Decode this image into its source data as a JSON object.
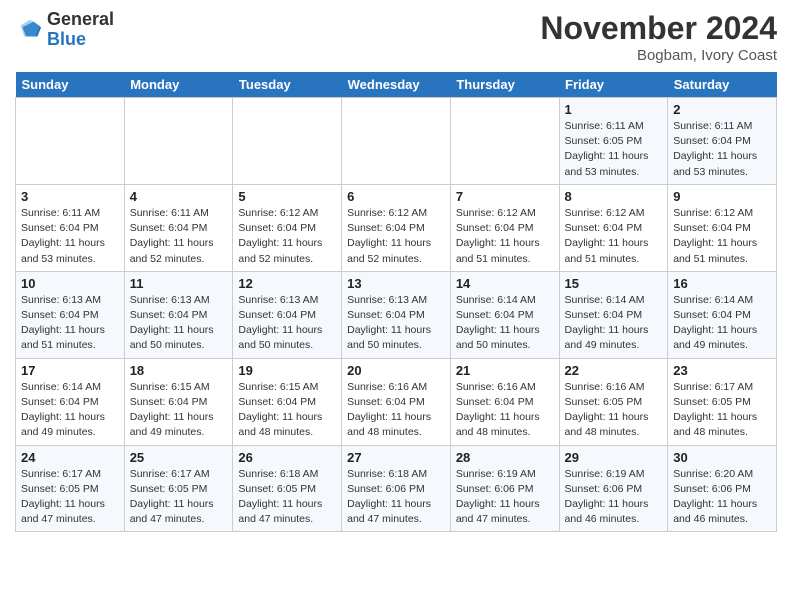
{
  "header": {
    "logo_line1": "General",
    "logo_line2": "Blue",
    "month": "November 2024",
    "location": "Bogbam, Ivory Coast"
  },
  "weekdays": [
    "Sunday",
    "Monday",
    "Tuesday",
    "Wednesday",
    "Thursday",
    "Friday",
    "Saturday"
  ],
  "weeks": [
    [
      {
        "day": "",
        "info": ""
      },
      {
        "day": "",
        "info": ""
      },
      {
        "day": "",
        "info": ""
      },
      {
        "day": "",
        "info": ""
      },
      {
        "day": "",
        "info": ""
      },
      {
        "day": "1",
        "info": "Sunrise: 6:11 AM\nSunset: 6:05 PM\nDaylight: 11 hours and 53 minutes."
      },
      {
        "day": "2",
        "info": "Sunrise: 6:11 AM\nSunset: 6:04 PM\nDaylight: 11 hours and 53 minutes."
      }
    ],
    [
      {
        "day": "3",
        "info": "Sunrise: 6:11 AM\nSunset: 6:04 PM\nDaylight: 11 hours and 53 minutes."
      },
      {
        "day": "4",
        "info": "Sunrise: 6:11 AM\nSunset: 6:04 PM\nDaylight: 11 hours and 52 minutes."
      },
      {
        "day": "5",
        "info": "Sunrise: 6:12 AM\nSunset: 6:04 PM\nDaylight: 11 hours and 52 minutes."
      },
      {
        "day": "6",
        "info": "Sunrise: 6:12 AM\nSunset: 6:04 PM\nDaylight: 11 hours and 52 minutes."
      },
      {
        "day": "7",
        "info": "Sunrise: 6:12 AM\nSunset: 6:04 PM\nDaylight: 11 hours and 51 minutes."
      },
      {
        "day": "8",
        "info": "Sunrise: 6:12 AM\nSunset: 6:04 PM\nDaylight: 11 hours and 51 minutes."
      },
      {
        "day": "9",
        "info": "Sunrise: 6:12 AM\nSunset: 6:04 PM\nDaylight: 11 hours and 51 minutes."
      }
    ],
    [
      {
        "day": "10",
        "info": "Sunrise: 6:13 AM\nSunset: 6:04 PM\nDaylight: 11 hours and 51 minutes."
      },
      {
        "day": "11",
        "info": "Sunrise: 6:13 AM\nSunset: 6:04 PM\nDaylight: 11 hours and 50 minutes."
      },
      {
        "day": "12",
        "info": "Sunrise: 6:13 AM\nSunset: 6:04 PM\nDaylight: 11 hours and 50 minutes."
      },
      {
        "day": "13",
        "info": "Sunrise: 6:13 AM\nSunset: 6:04 PM\nDaylight: 11 hours and 50 minutes."
      },
      {
        "day": "14",
        "info": "Sunrise: 6:14 AM\nSunset: 6:04 PM\nDaylight: 11 hours and 50 minutes."
      },
      {
        "day": "15",
        "info": "Sunrise: 6:14 AM\nSunset: 6:04 PM\nDaylight: 11 hours and 49 minutes."
      },
      {
        "day": "16",
        "info": "Sunrise: 6:14 AM\nSunset: 6:04 PM\nDaylight: 11 hours and 49 minutes."
      }
    ],
    [
      {
        "day": "17",
        "info": "Sunrise: 6:14 AM\nSunset: 6:04 PM\nDaylight: 11 hours and 49 minutes."
      },
      {
        "day": "18",
        "info": "Sunrise: 6:15 AM\nSunset: 6:04 PM\nDaylight: 11 hours and 49 minutes."
      },
      {
        "day": "19",
        "info": "Sunrise: 6:15 AM\nSunset: 6:04 PM\nDaylight: 11 hours and 48 minutes."
      },
      {
        "day": "20",
        "info": "Sunrise: 6:16 AM\nSunset: 6:04 PM\nDaylight: 11 hours and 48 minutes."
      },
      {
        "day": "21",
        "info": "Sunrise: 6:16 AM\nSunset: 6:04 PM\nDaylight: 11 hours and 48 minutes."
      },
      {
        "day": "22",
        "info": "Sunrise: 6:16 AM\nSunset: 6:05 PM\nDaylight: 11 hours and 48 minutes."
      },
      {
        "day": "23",
        "info": "Sunrise: 6:17 AM\nSunset: 6:05 PM\nDaylight: 11 hours and 48 minutes."
      }
    ],
    [
      {
        "day": "24",
        "info": "Sunrise: 6:17 AM\nSunset: 6:05 PM\nDaylight: 11 hours and 47 minutes."
      },
      {
        "day": "25",
        "info": "Sunrise: 6:17 AM\nSunset: 6:05 PM\nDaylight: 11 hours and 47 minutes."
      },
      {
        "day": "26",
        "info": "Sunrise: 6:18 AM\nSunset: 6:05 PM\nDaylight: 11 hours and 47 minutes."
      },
      {
        "day": "27",
        "info": "Sunrise: 6:18 AM\nSunset: 6:06 PM\nDaylight: 11 hours and 47 minutes."
      },
      {
        "day": "28",
        "info": "Sunrise: 6:19 AM\nSunset: 6:06 PM\nDaylight: 11 hours and 47 minutes."
      },
      {
        "day": "29",
        "info": "Sunrise: 6:19 AM\nSunset: 6:06 PM\nDaylight: 11 hours and 46 minutes."
      },
      {
        "day": "30",
        "info": "Sunrise: 6:20 AM\nSunset: 6:06 PM\nDaylight: 11 hours and 46 minutes."
      }
    ]
  ]
}
